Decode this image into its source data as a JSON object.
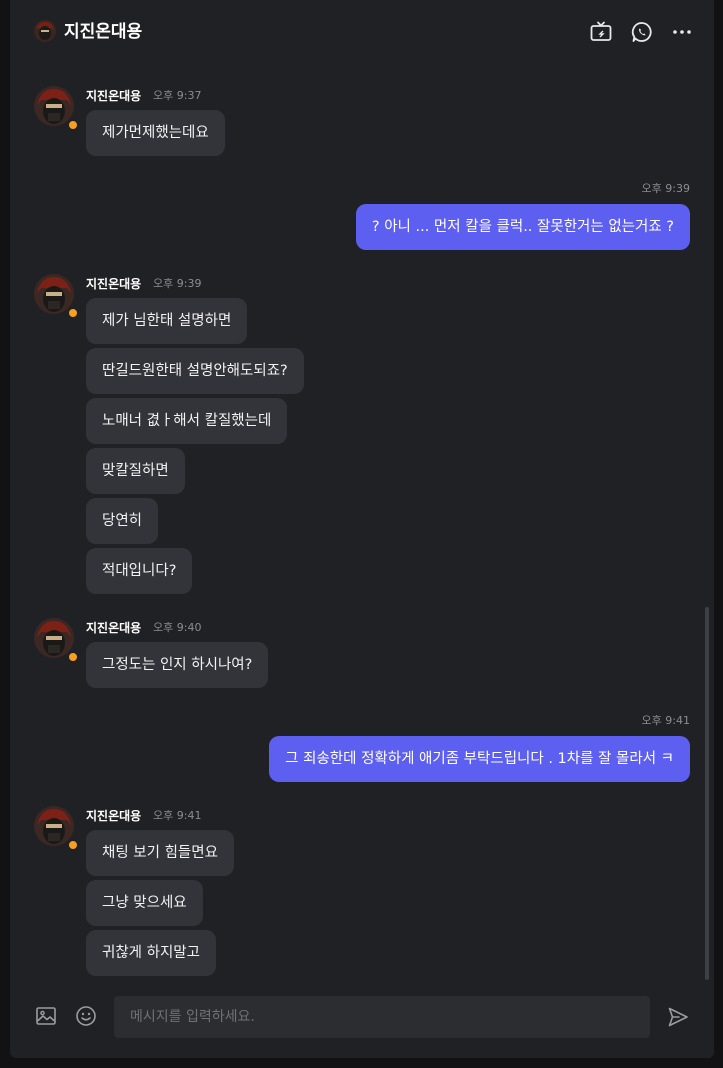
{
  "header": {
    "title": "지진온대용",
    "icons": [
      "tv-icon",
      "whatsapp-icon",
      "more-icon"
    ]
  },
  "messages": {
    "g1": {
      "name": "지진온대용",
      "time": "오후 9:37",
      "texts": [
        "제가먼제했는데요"
      ]
    },
    "o1": {
      "time": "오후 9:39",
      "texts": [
        "? 아니 ... 먼저 칼을 클럭.. 잘못한거는 없는거죠 ?"
      ]
    },
    "g2": {
      "name": "지진온대용",
      "time": "오후 9:39",
      "texts": [
        "제가 님한태 설명하면",
        "딴길드원한태 설명안해도되죠?",
        "노매너 겺ㅏ해서 칼질했는데",
        "맞칼질하면",
        "당연히",
        "적대입니다?"
      ]
    },
    "g3": {
      "name": "지진온대용",
      "time": "오후 9:40",
      "texts": [
        "그정도는 인지 하시나여?"
      ]
    },
    "o2": {
      "time": "오후 9:41",
      "texts": [
        "그 죄송한데 정확하게 애기좀 부탁드립니다 . 1차를 잘 몰라서 ㅋ"
      ]
    },
    "g4": {
      "name": "지진온대용",
      "time": "오후 9:41",
      "texts": [
        "채팅 보기 힘들면요",
        "그냥 맞으세요",
        "귀찮게 하지말고"
      ]
    }
  },
  "composer": {
    "placeholder": "메시지를 입력하세요."
  },
  "colors": {
    "background": "#202124",
    "incoming_bubble": "#33343a",
    "outgoing_bubble": "#5d5ff0",
    "status_dot": "#f5a020"
  }
}
